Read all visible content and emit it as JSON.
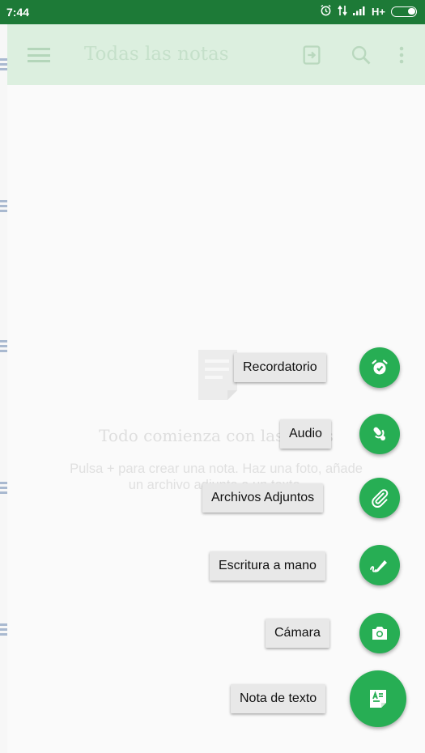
{
  "status_bar": {
    "time": "7:44",
    "network": "H+",
    "icons": [
      "alarm-icon",
      "data-arrows-icon",
      "signal-icon",
      "battery-icon"
    ]
  },
  "toolbar": {
    "title": "Todas las notas",
    "icons": [
      "menu-icon",
      "sync-icon",
      "search-icon",
      "more-vert-icon"
    ]
  },
  "empty_state": {
    "title": "Todo comienza con las notas",
    "description": "Pulsa + para crear una nota. Haz una foto, añade un archivo adjunto o un texto."
  },
  "fab_menu": {
    "items": [
      {
        "label": "Recordatorio",
        "icon": "alarm-icon"
      },
      {
        "label": "Audio",
        "icon": "microphone-icon"
      },
      {
        "label": "Archivos Adjuntos",
        "icon": "paperclip-icon"
      },
      {
        "label": "Escritura a mano",
        "icon": "handwriting-icon"
      },
      {
        "label": "Cámara",
        "icon": "camera-icon"
      },
      {
        "label": "Nota de texto",
        "icon": "text-note-icon"
      }
    ]
  },
  "colors": {
    "status_bar": "#1d7a37",
    "accent": "#27ae54",
    "toolbar_dimmed": "#dcefdf"
  }
}
